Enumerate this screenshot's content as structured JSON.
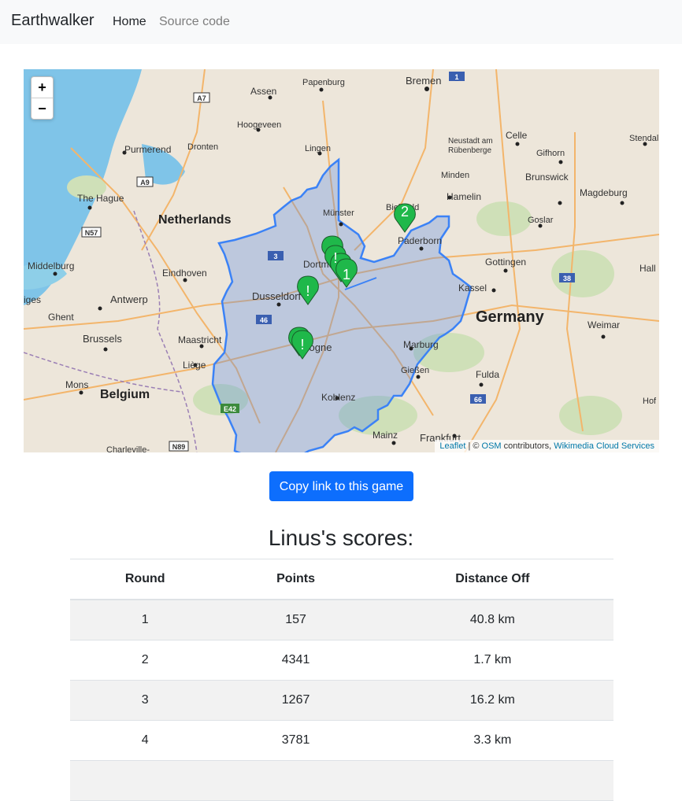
{
  "navbar": {
    "brand": "Earthwalker",
    "links": [
      "Home",
      "Source code"
    ]
  },
  "map": {
    "zoom_in": "+",
    "zoom_out": "−",
    "attribution": {
      "leaflet": "Leaflet",
      "separator": " | © ",
      "osm": "OSM",
      "contributors": " contributors, ",
      "tiles": "Wikimedia Cloud Services"
    },
    "labels": {
      "netherlands": "Netherlands",
      "belgium": "Belgium",
      "germany": "Germany",
      "bremen": "Bremen",
      "papenburg": "Papenburg",
      "assen": "Assen",
      "hoogeveen": "Hoogeveen",
      "lingen": "Lingen",
      "purmerend": "Purmerend",
      "dronten": "Dronten",
      "the_hague": "The Hague",
      "munster": "Münster",
      "bielefeld": "Bielefeld",
      "paderborn": "Paderborn",
      "dortmund": "Dortmund",
      "dusseldorf": "Dusseldorf",
      "cologne": "Cologne",
      "eindhoven": "Eindhoven",
      "antwerp": "Antwerp",
      "brussels": "Brussels",
      "maastricht": "Maastricht",
      "liege": "Liège",
      "mons": "Mons",
      "ghent": "Ghent",
      "middelburg": "Middelburg",
      "minden": "Minden",
      "hamelin": "Hamelin",
      "brunswick": "Brunswick",
      "magdeburg": "Magdeburg",
      "celle": "Celle",
      "gifhorn": "Gifhorn",
      "goslar": "Goslar",
      "gottingen": "Gottingen",
      "kassel": "Kassel",
      "weimar": "Weimar",
      "marburg": "Marburg",
      "giessen": "Gießen",
      "fulda": "Fulda",
      "koblenz": "Koblenz",
      "mainz": "Mainz",
      "frankfurt": "Frankfurt",
      "neustadt": "Neustadt am",
      "rubenberge": "Rübenberge",
      "stendal": "Stendal",
      "hof": "Hof",
      "charleville": "Charleville-",
      "halle": "Hall",
      "ges": "iges"
    },
    "road_shields": [
      "A7",
      "A9",
      "N57",
      "1",
      "3",
      "46",
      "38",
      "66",
      "E42",
      "N89"
    ],
    "markers": [
      {
        "label": "2",
        "color": "#22c55e"
      },
      {
        "label": "1",
        "color": "#22c55e"
      },
      {
        "label": "!",
        "color": "#22c55e"
      },
      {
        "label": "!",
        "color": "#22c55e"
      },
      {
        "label": "!",
        "color": "#22c55e"
      }
    ]
  },
  "copy_button": "Copy link to this game",
  "scores": {
    "title": "Linus's scores:",
    "headers": [
      "Round",
      "Points",
      "Distance Off"
    ],
    "rows": [
      {
        "round": "1",
        "points": "157",
        "distance": "40.8 km"
      },
      {
        "round": "2",
        "points": "4341",
        "distance": "1.7 km"
      },
      {
        "round": "3",
        "points": "1267",
        "distance": "16.2 km"
      },
      {
        "round": "4",
        "points": "3781",
        "distance": "3.3 km"
      },
      {
        "round": "",
        "points": "",
        "distance": ""
      }
    ]
  }
}
